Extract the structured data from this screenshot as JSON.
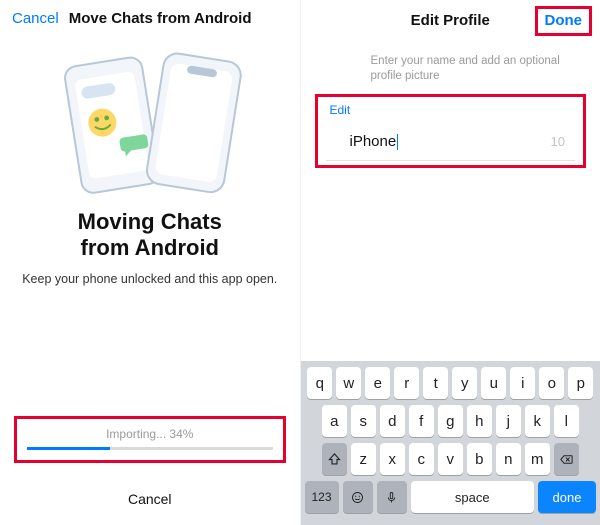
{
  "left": {
    "cancel": "Cancel",
    "header_title": "Move Chats from Android",
    "main_title_l1": "Moving Chats",
    "main_title_l2": "from Android",
    "subtitle": "Keep your phone unlocked and this app open.",
    "import_label": "Importing... 34%",
    "progress_percent": 34,
    "bottom_cancel": "Cancel"
  },
  "right": {
    "title": "Edit Profile",
    "done": "Done",
    "hint": "Enter your name and add an optional profile picture",
    "edit_label": "Edit",
    "name_value": "iPhone",
    "name_count": "10"
  },
  "keyboard": {
    "row1": [
      "q",
      "w",
      "e",
      "r",
      "t",
      "y",
      "u",
      "i",
      "o",
      "p"
    ],
    "row2": [
      "a",
      "s",
      "d",
      "f",
      "g",
      "h",
      "j",
      "k",
      "l"
    ],
    "row3": [
      "z",
      "x",
      "c",
      "v",
      "b",
      "n",
      "m"
    ],
    "num": "123",
    "space": "space",
    "done": "done"
  }
}
